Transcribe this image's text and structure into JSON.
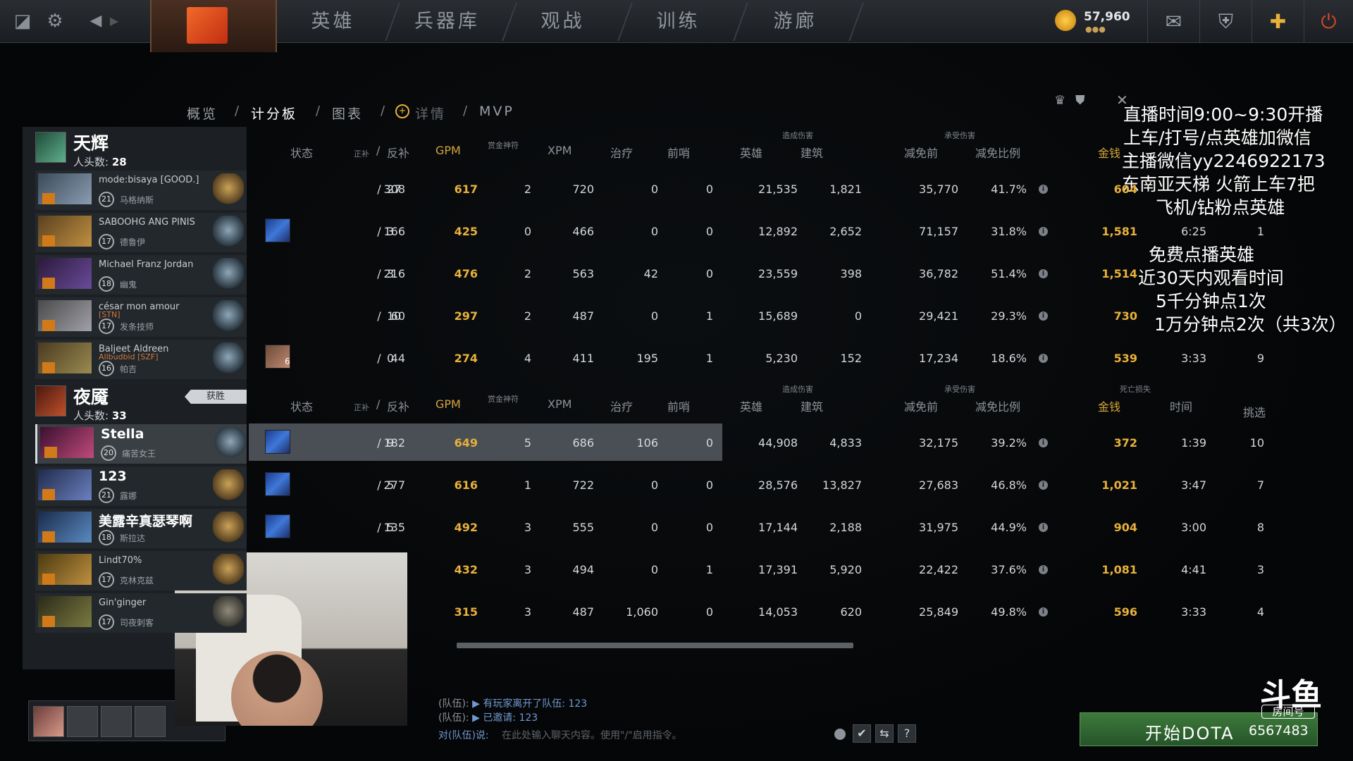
{
  "nav": {
    "tabs": [
      "英雄",
      "兵器库",
      "观战",
      "训练",
      "游廊"
    ],
    "gold": "57,960",
    "gold_dots": "●●●"
  },
  "subtabs": {
    "overview": "概览",
    "scoreboard": "计分板",
    "graphs": "图表",
    "details": "详情",
    "mvp": "MVP",
    "sep": "/"
  },
  "headers": {
    "status": "状态",
    "kills": "正补",
    "slash": "/",
    "denies": "反补",
    "gpm": "GPM",
    "bounty": "赏金神符",
    "xpm": "XPM",
    "heal": "治疗",
    "wards": "前哨",
    "dmg_group": "造成伤害",
    "hero": "英雄",
    "building": "建筑",
    "taken_group": "承受伤害",
    "before": "减免前",
    "ratio": "减免比例",
    "death_group": "死亡损失",
    "gold": "金钱",
    "time": "时间",
    "pick": "挑选"
  },
  "radiant": {
    "name": "天辉",
    "kills_label": "人头数:",
    "kills": "28",
    "players": [
      {
        "name": "mode:bisaya [GOOD.]",
        "level": "21",
        "hero": "马格纳斯",
        "lh": "308",
        "dn": "27",
        "gpm": "617",
        "bounty": "2",
        "xpm": "720",
        "heal": "0",
        "wards": "0",
        "hero_dmg": "21,535",
        "bld": "1,821",
        "before": "35,770",
        "ratio": "41.7%",
        "gold": "604",
        "time": "",
        "pick": ""
      },
      {
        "name": "SABOOHG ANG PINIS",
        "level": "17",
        "hero": "德鲁伊",
        "lh": "166",
        "dn": "3",
        "gpm": "425",
        "bounty": "0",
        "xpm": "466",
        "heal": "0",
        "wards": "0",
        "hero_dmg": "12,892",
        "bld": "2,652",
        "before": "71,157",
        "ratio": "31.8%",
        "gold": "1,581",
        "time": "6:25",
        "pick": "1"
      },
      {
        "name": "Michael Franz Jordan",
        "level": "18",
        "hero": "幽鬼",
        "lh": "216",
        "dn": "3",
        "gpm": "476",
        "bounty": "2",
        "xpm": "563",
        "heal": "42",
        "wards": "0",
        "hero_dmg": "23,559",
        "bld": "398",
        "before": "36,782",
        "ratio": "51.4%",
        "gold": "1,514",
        "time": "",
        "pick": ""
      },
      {
        "name": "césar mon amour",
        "sub": "[STN]",
        "level": "17",
        "hero": "发条技师",
        "lh": "60",
        "dn": "10",
        "gpm": "297",
        "bounty": "2",
        "xpm": "487",
        "heal": "0",
        "wards": "1",
        "hero_dmg": "15,689",
        "bld": "0",
        "before": "29,421",
        "ratio": "29.3%",
        "gold": "730",
        "time": "",
        "pick": ""
      },
      {
        "name": "Baljeet Aldreen",
        "sub": "Allbudbid [SZF]",
        "level": "16",
        "hero": "帕吉",
        "lh": "44",
        "dn": "0",
        "gpm": "274",
        "bounty": "4",
        "xpm": "411",
        "heal": "195",
        "wards": "1",
        "hero_dmg": "5,230",
        "bld": "152",
        "before": "17,234",
        "ratio": "18.6%",
        "gold": "539",
        "time": "3:33",
        "pick": "9"
      }
    ]
  },
  "dire": {
    "name": "夜魇",
    "kills_label": "人头数:",
    "kills": "33",
    "victory": "获胜",
    "players": [
      {
        "name": "Stella",
        "level": "20",
        "hero": "痛苦女王",
        "lh": "182",
        "dn": "9",
        "gpm": "649",
        "bounty": "5",
        "xpm": "686",
        "heal": "106",
        "wards": "0",
        "hero_dmg": "44,908",
        "bld": "4,833",
        "before": "32,175",
        "ratio": "39.2%",
        "gold": "372",
        "time": "1:39",
        "pick": "10"
      },
      {
        "name": "123",
        "level": "21",
        "hero": "露娜",
        "lh": "277",
        "dn": "5",
        "gpm": "616",
        "bounty": "1",
        "xpm": "722",
        "heal": "0",
        "wards": "0",
        "hero_dmg": "28,576",
        "bld": "13,827",
        "before": "27,683",
        "ratio": "46.8%",
        "gold": "1,021",
        "time": "3:47",
        "pick": "7"
      },
      {
        "name": "美露辛真瑟琴啊",
        "level": "18",
        "hero": "斯拉达",
        "lh": "135",
        "dn": "5",
        "gpm": "492",
        "bounty": "3",
        "xpm": "555",
        "heal": "0",
        "wards": "0",
        "hero_dmg": "17,144",
        "bld": "2,188",
        "before": "31,975",
        "ratio": "44.9%",
        "gold": "904",
        "time": "3:00",
        "pick": "8"
      },
      {
        "name": "Lindt70%",
        "level": "17",
        "hero": "克林克兹",
        "lh": "",
        "dn": "",
        "gpm": "432",
        "bounty": "3",
        "xpm": "494",
        "heal": "0",
        "wards": "1",
        "hero_dmg": "17,391",
        "bld": "5,920",
        "before": "22,422",
        "ratio": "37.6%",
        "gold": "1,081",
        "time": "4:41",
        "pick": "3"
      },
      {
        "name": "Gin'ginger",
        "level": "17",
        "hero": "司夜刺客",
        "lh": "",
        "dn": "",
        "gpm": "315",
        "bounty": "3",
        "xpm": "487",
        "heal": "1,060",
        "wards": "0",
        "hero_dmg": "14,053",
        "bld": "620",
        "before": "25,849",
        "ratio": "49.8%",
        "gold": "596",
        "time": "3:33",
        "pick": "4"
      }
    ]
  },
  "overlay": {
    "l1": "直播时间9:00~9:30开播",
    "l2": "上车/打号/点英雄加微信",
    "l3": "主播微信yy2246922173",
    "l4": "东南亚天梯 火箭上车7把",
    "l5": "飞机/钻粉点英雄",
    "l6": "免费点播英雄",
    "l7": "近30天内观看时间",
    "l8": "5千分钟点1次",
    "l9": "1万分钟点2次（共3次）"
  },
  "chat": {
    "tag": "(队伍):",
    "msg1": "有玩家离开了队伍: 123",
    "msg2": "已邀请: 123",
    "say_label": "对(队伍)说:",
    "placeholder": "在此处输入聊天内容。使用\"/\"启用指令。"
  },
  "bottom": {
    "start": "开始DOTA",
    "douyu": "斗鱼",
    "room_tag": "房间号",
    "room": "6567483",
    "help": "?"
  }
}
